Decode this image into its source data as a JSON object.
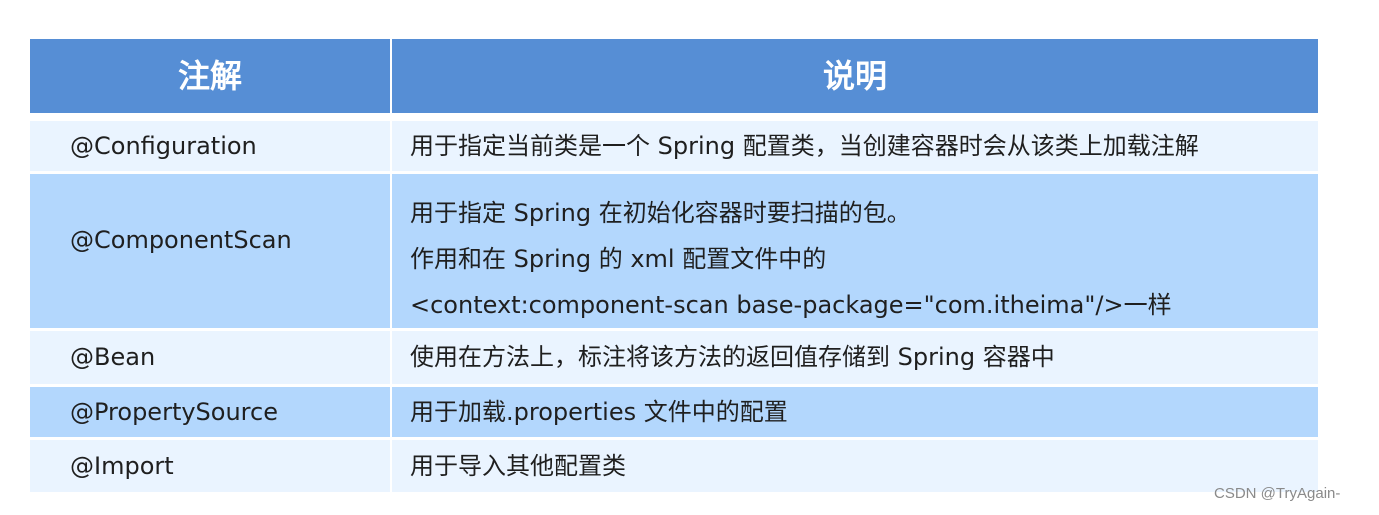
{
  "table": {
    "headers": [
      "注解",
      "说明"
    ],
    "rows": [
      {
        "annotation": "@Configuration",
        "description": [
          "用于指定当前类是一个  Spring  配置类，当创建容器时会从该类上加载注解"
        ]
      },
      {
        "annotation": "@ComponentScan",
        "description": [
          "用于指定 Spring  在初始化容器时要扫描的包。",
          "作用和在 Spring  的 xml  配置文件中的",
          "<context:component-scan  base-package=\"com.itheima\"/>一样"
        ]
      },
      {
        "annotation": "@Bean",
        "description": [
          "使用在方法上，标注将该方法的返回值存储到  Spring 容器中"
        ]
      },
      {
        "annotation": "@PropertySource",
        "description": [
          "用于加载.properties  文件中的配置"
        ]
      },
      {
        "annotation": "@Import",
        "description": [
          "用于导入其他配置类"
        ]
      }
    ]
  },
  "watermark": "CSDN @TryAgain-",
  "colors": {
    "header": "#568ed5",
    "row_light": "#eaf4ff",
    "row_dark": "#b3d7fd"
  }
}
